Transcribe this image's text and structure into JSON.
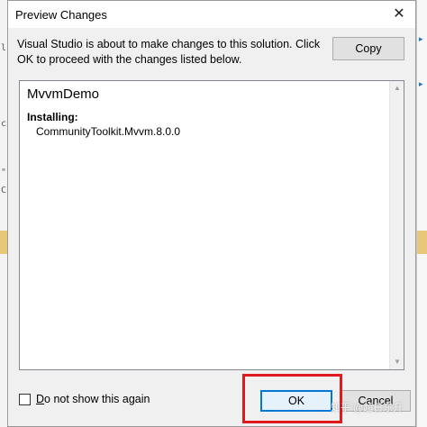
{
  "dialog": {
    "title": "Preview Changes",
    "close_glyph": "✕",
    "message": "Visual Studio is about to make changes to this solution. Click OK to proceed with the changes listed below.",
    "copy_label": "Copy"
  },
  "changes": {
    "project": "MvvmDemo",
    "installing_label": "Installing:",
    "package": "CommunityToolkit.Mvvm.8.0.0"
  },
  "footer": {
    "dont_show_prefix": "D",
    "dont_show_rest": "o not show this again",
    "dont_show_checked": false,
    "ok_label": "OK",
    "cancel_label": "Cancel"
  },
  "watermark": "知乎 @超日东升",
  "colors": {
    "highlight": "#e0191f",
    "default_button_border": "#0078d7"
  },
  "icons": {
    "close": "close-icon",
    "scroll_up": "scroll-up-arrow-icon",
    "scroll_down": "scroll-down-arrow-icon"
  }
}
